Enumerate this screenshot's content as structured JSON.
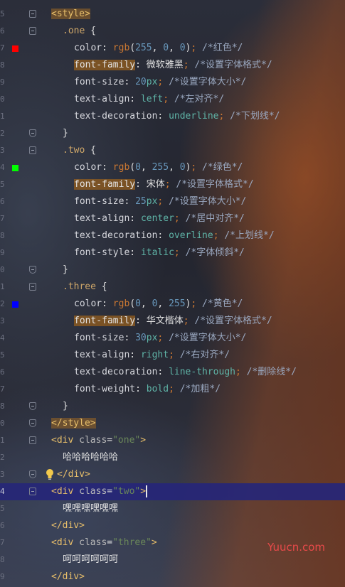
{
  "editor": {
    "lines": [
      {
        "num": "5",
        "fold": "open",
        "tokens": [
          [
            "tag tagbox",
            "<style>"
          ]
        ]
      },
      {
        "num": "6",
        "fold": "open",
        "tokens": [
          [
            "sel",
            ".one"
          ],
          [
            "text",
            " {"
          ]
        ]
      },
      {
        "num": "7",
        "swatch": "#ff0000",
        "tokens": [
          [
            "prop",
            "color"
          ],
          [
            "text",
            ": "
          ],
          [
            "fn",
            "rgb"
          ],
          [
            "text",
            "("
          ],
          [
            "num-lit",
            "255"
          ],
          [
            "text",
            ", "
          ],
          [
            "num-lit",
            "0"
          ],
          [
            "text",
            ", "
          ],
          [
            "num-lit",
            "0"
          ],
          [
            "text",
            ")"
          ],
          [
            "punct",
            ";"
          ],
          [
            "text",
            " "
          ],
          [
            "comment",
            "/*红色*/"
          ]
        ]
      },
      {
        "num": "8",
        "tokens": [
          [
            "propbox",
            "font-family"
          ],
          [
            "text",
            ": 微软雅黑"
          ],
          [
            "punct",
            ";"
          ],
          [
            "text",
            " "
          ],
          [
            "comment",
            "/*设置字体格式*/"
          ]
        ]
      },
      {
        "num": "9",
        "tokens": [
          [
            "prop",
            "font-size"
          ],
          [
            "text",
            ": "
          ],
          [
            "num-lit",
            "20"
          ],
          [
            "val",
            "px"
          ],
          [
            "punct",
            ";"
          ],
          [
            "text",
            " "
          ],
          [
            "comment",
            "/*设置字体大小*/"
          ]
        ]
      },
      {
        "num": "0",
        "tokens": [
          [
            "prop",
            "text-align"
          ],
          [
            "text",
            ": "
          ],
          [
            "val",
            "left"
          ],
          [
            "punct",
            ";"
          ],
          [
            "text",
            " "
          ],
          [
            "comment",
            "/*左对齐*/"
          ]
        ]
      },
      {
        "num": "1",
        "tokens": [
          [
            "prop",
            "text-decoration"
          ],
          [
            "text",
            ": "
          ],
          [
            "val",
            "underline"
          ],
          [
            "punct",
            ";"
          ],
          [
            "text",
            " "
          ],
          [
            "comment",
            "/*下划线*/"
          ]
        ]
      },
      {
        "num": "2",
        "fold": "end",
        "tokens": [
          [
            "text",
            "}"
          ]
        ]
      },
      {
        "num": "3",
        "fold": "open",
        "tokens": [
          [
            "sel",
            ".two"
          ],
          [
            "text",
            " {"
          ]
        ]
      },
      {
        "num": "4",
        "swatch": "#00ff00",
        "tokens": [
          [
            "prop",
            "color"
          ],
          [
            "text",
            ": "
          ],
          [
            "fn",
            "rgb"
          ],
          [
            "text",
            "("
          ],
          [
            "num-lit",
            "0"
          ],
          [
            "text",
            ", "
          ],
          [
            "num-lit",
            "255"
          ],
          [
            "text",
            ", "
          ],
          [
            "num-lit",
            "0"
          ],
          [
            "text",
            ")"
          ],
          [
            "punct",
            ";"
          ],
          [
            "text",
            " "
          ],
          [
            "comment",
            "/*绿色*/"
          ]
        ]
      },
      {
        "num": "5",
        "tokens": [
          [
            "propbox",
            "font-family"
          ],
          [
            "text",
            ": 宋体"
          ],
          [
            "punct",
            ";"
          ],
          [
            "text",
            " "
          ],
          [
            "comment",
            "/*设置字体格式*/"
          ]
        ]
      },
      {
        "num": "6",
        "tokens": [
          [
            "prop",
            "font-size"
          ],
          [
            "text",
            ": "
          ],
          [
            "num-lit",
            "25"
          ],
          [
            "val",
            "px"
          ],
          [
            "punct",
            ";"
          ],
          [
            "text",
            " "
          ],
          [
            "comment",
            "/*设置字体大小*/"
          ]
        ]
      },
      {
        "num": "7",
        "tokens": [
          [
            "prop",
            "text-align"
          ],
          [
            "text",
            ": "
          ],
          [
            "val",
            "center"
          ],
          [
            "punct",
            ";"
          ],
          [
            "text",
            " "
          ],
          [
            "comment",
            "/*居中对齐*/"
          ]
        ]
      },
      {
        "num": "8",
        "tokens": [
          [
            "prop",
            "text-decoration"
          ],
          [
            "text",
            ": "
          ],
          [
            "val",
            "overline"
          ],
          [
            "punct",
            ";"
          ],
          [
            "text",
            " "
          ],
          [
            "comment",
            "/*上划线*/"
          ]
        ]
      },
      {
        "num": "9",
        "tokens": [
          [
            "prop",
            "font-style"
          ],
          [
            "text",
            ": "
          ],
          [
            "val",
            "italic"
          ],
          [
            "punct",
            ";"
          ],
          [
            "text",
            " "
          ],
          [
            "comment",
            "/*字体倾斜*/"
          ]
        ]
      },
      {
        "num": "0",
        "fold": "end",
        "tokens": [
          [
            "text",
            "}"
          ]
        ]
      },
      {
        "num": "1",
        "fold": "open",
        "tokens": [
          [
            "sel",
            ".three"
          ],
          [
            "text",
            " {"
          ]
        ]
      },
      {
        "num": "2",
        "swatch": "#0000ff",
        "tokens": [
          [
            "prop",
            "color"
          ],
          [
            "text",
            ": "
          ],
          [
            "fn",
            "rgb"
          ],
          [
            "text",
            "("
          ],
          [
            "num-lit",
            "0"
          ],
          [
            "text",
            ", "
          ],
          [
            "num-lit",
            "0"
          ],
          [
            "text",
            ", "
          ],
          [
            "num-lit",
            "255"
          ],
          [
            "text",
            ")"
          ],
          [
            "punct",
            ";"
          ],
          [
            "text",
            " "
          ],
          [
            "comment",
            "/*黄色*/"
          ]
        ]
      },
      {
        "num": "3",
        "tokens": [
          [
            "propbox",
            "font-family"
          ],
          [
            "text",
            ": 华文楷体"
          ],
          [
            "punct",
            ";"
          ],
          [
            "text",
            " "
          ],
          [
            "comment",
            "/*设置字体格式*/"
          ]
        ]
      },
      {
        "num": "4",
        "tokens": [
          [
            "prop",
            "font-size"
          ],
          [
            "text",
            ": "
          ],
          [
            "num-lit",
            "30"
          ],
          [
            "val",
            "px"
          ],
          [
            "punct",
            ";"
          ],
          [
            "text",
            " "
          ],
          [
            "comment",
            "/*设置字体大小*/"
          ]
        ]
      },
      {
        "num": "5",
        "tokens": [
          [
            "prop",
            "text-align"
          ],
          [
            "text",
            ": "
          ],
          [
            "val",
            "right"
          ],
          [
            "punct",
            ";"
          ],
          [
            "text",
            " "
          ],
          [
            "comment",
            "/*右对齐*/"
          ]
        ]
      },
      {
        "num": "6",
        "tokens": [
          [
            "prop",
            "text-decoration"
          ],
          [
            "text",
            ": "
          ],
          [
            "val",
            "line-through"
          ],
          [
            "punct",
            ";"
          ],
          [
            "text",
            " "
          ],
          [
            "comment",
            "/*删除线*/"
          ]
        ]
      },
      {
        "num": "7",
        "tokens": [
          [
            "prop",
            "font-weight"
          ],
          [
            "text",
            ": "
          ],
          [
            "val",
            "bold"
          ],
          [
            "punct",
            ";"
          ],
          [
            "text",
            " "
          ],
          [
            "comment",
            "/*加粗*/"
          ]
        ]
      },
      {
        "num": "8",
        "fold": "end",
        "tokens": [
          [
            "text",
            "}"
          ]
        ]
      },
      {
        "num": "0",
        "fold": "end",
        "tokens": [
          [
            "tag tagbox",
            "</style>"
          ]
        ]
      },
      {
        "num": "1",
        "fold": "open",
        "tokens": [
          [
            "tag",
            "<div "
          ],
          [
            "attr",
            "class"
          ],
          [
            "text",
            "="
          ],
          [
            "attrval",
            "\"one\""
          ],
          [
            "tag",
            ">"
          ]
        ]
      },
      {
        "num": "2",
        "tokens": [
          [
            "text",
            "哈哈哈哈哈哈"
          ]
        ]
      },
      {
        "num": "3",
        "fold": "end",
        "bulb": true,
        "tokens": [
          [
            "tag",
            "</div>"
          ]
        ]
      },
      {
        "num": "4",
        "fold": "open",
        "active": true,
        "caret": true,
        "tokens": [
          [
            "tag",
            "<div "
          ],
          [
            "attr",
            "class"
          ],
          [
            "text",
            "="
          ],
          [
            "attrval",
            "\"two\""
          ],
          [
            "tag",
            ">"
          ]
        ]
      },
      {
        "num": "5",
        "tokens": [
          [
            "text",
            "嘿嘿嘿嘿嘿嘿"
          ]
        ]
      },
      {
        "num": "6",
        "tokens": [
          [
            "tag",
            "</div>"
          ]
        ]
      },
      {
        "num": "7",
        "tokens": [
          [
            "tag",
            "<div "
          ],
          [
            "attr",
            "class"
          ],
          [
            "text",
            "="
          ],
          [
            "attrval",
            "\"three\""
          ],
          [
            "tag",
            ">"
          ]
        ]
      },
      {
        "num": "8",
        "tokens": [
          [
            "text",
            "呵呵呵呵呵呵"
          ]
        ]
      },
      {
        "num": "9",
        "tokens": [
          [
            "tag",
            "</div>"
          ]
        ]
      }
    ],
    "indents": [
      72,
      88,
      104,
      104,
      104,
      104,
      104,
      88,
      88,
      104,
      104,
      104,
      104,
      104,
      104,
      88,
      88,
      104,
      104,
      104,
      104,
      104,
      104,
      88,
      72,
      72,
      88,
      80,
      72,
      88,
      72,
      72,
      88,
      72
    ]
  },
  "watermark": "Yuucn.com"
}
